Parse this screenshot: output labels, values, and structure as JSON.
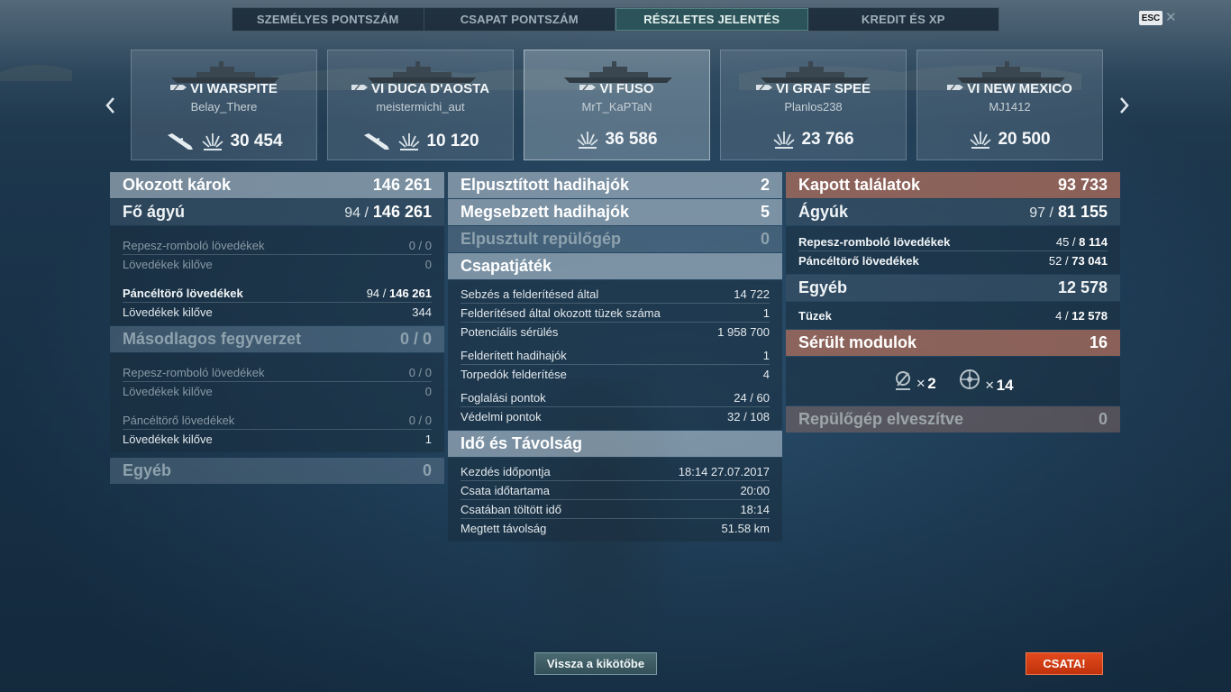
{
  "tabs": [
    {
      "label": "SZEMÉLYES PONTSZÁM",
      "active": false
    },
    {
      "label": "CSAPAT PONTSZÁM",
      "active": false
    },
    {
      "label": "RÉSZLETES JELENTÉS",
      "active": true
    },
    {
      "label": "KREDIT ÉS XP",
      "active": false
    }
  ],
  "esc_label": "ESC",
  "close_glyph": "✕",
  "ships": [
    {
      "tier": "VI",
      "name": "WARSPITE",
      "player": "Belay_There",
      "damage": "30 454",
      "killed": true
    },
    {
      "tier": "VI",
      "name": "DUCA D'AOSTA",
      "player": "meistermichi_aut",
      "damage": "10 120",
      "killed": true
    },
    {
      "tier": "VI",
      "name": "FUSO",
      "player": "MrT_KaPTaN",
      "damage": "36 586",
      "killed": false,
      "selected": true
    },
    {
      "tier": "VI",
      "name": "GRAF SPEE",
      "player": "Planlos238",
      "damage": "23 766",
      "killed": false
    },
    {
      "tier": "VI",
      "name": "NEW MEXICO",
      "player": "MJ1412",
      "damage": "20 500",
      "killed": false
    }
  ],
  "left": {
    "damage_dealt": {
      "label": "Okozott károk",
      "value": "146 261"
    },
    "main_guns": {
      "label": "Fő ágyú",
      "hits": "94 /",
      "dmg": "146 261"
    },
    "he": {
      "label": "Repesz-romboló lövedékek",
      "value": "0 / 0"
    },
    "he_fired": {
      "label": "Lövedékek kilőve",
      "value": "0"
    },
    "ap": {
      "label": "Páncéltörő lövedékek",
      "hits": "94 /",
      "dmg": "146 261"
    },
    "ap_fired": {
      "label": "Lövedékek kilőve",
      "value": "344"
    },
    "secondary": {
      "label": "Másodlagos fegyverzet",
      "value": "0 / 0"
    },
    "sec_he": {
      "label": "Repesz-romboló lövedékek",
      "value": "0 / 0"
    },
    "sec_he_fired": {
      "label": "Lövedékek kilőve",
      "value": "0"
    },
    "sec_ap": {
      "label": "Páncéltörő lövedékek",
      "value": "0 / 0"
    },
    "sec_ap_fired": {
      "label": "Lövedékek kilőve",
      "value": "1"
    },
    "other": {
      "label": "Egyéb",
      "value": "0"
    }
  },
  "middle": {
    "destroyed": {
      "label": "Elpusztított hadihajók",
      "value": "2"
    },
    "damaged": {
      "label": "Megsebzett hadihajók",
      "value": "5"
    },
    "planes": {
      "label": "Elpusztult repülőgép",
      "value": "0"
    },
    "teamplay": {
      "label": "Csapatjáték"
    },
    "spot_dmg": {
      "label": "Sebzés a felderítésed által",
      "value": "14 722"
    },
    "spot_fires": {
      "label": "Felderítésed által okozott tüzek száma",
      "value": "1"
    },
    "potential": {
      "label": "Potenciális sérülés",
      "value": "1 958 700"
    },
    "spotted": {
      "label": "Felderített hadihajók",
      "value": "1"
    },
    "torp_spot": {
      "label": "Torpedók felderítése",
      "value": "4"
    },
    "capture": {
      "label": "Foglalási pontok",
      "value": "24 / 60"
    },
    "defense": {
      "label": "Védelmi pontok",
      "value": "32 / 108"
    },
    "time": {
      "label": "Idő és Távolság"
    },
    "start": {
      "label": "Kezdés időpontja",
      "value": "18:14  27.07.2017"
    },
    "duration": {
      "label": "Csata időtartama",
      "value": "20:00"
    },
    "in_battle": {
      "label": "Csatában töltött idő",
      "value": "18:14"
    },
    "distance": {
      "label": "Megtett távolság",
      "value": "51.58 km"
    }
  },
  "right": {
    "received": {
      "label": "Kapott találatok",
      "value": "93 733"
    },
    "guns": {
      "label": "Ágyúk",
      "hits": "97 /",
      "dmg": "81 155"
    },
    "he": {
      "label": "Repesz-romboló lövedékek",
      "hits": "45 /",
      "dmg": "8 114"
    },
    "ap": {
      "label": "Páncéltörő lövedékek",
      "hits": "52 /",
      "dmg": "73 041"
    },
    "other": {
      "label": "Egyéb",
      "value": "12 578"
    },
    "fires": {
      "label": "Tüzek",
      "hits": "4 /",
      "dmg": "12 578"
    },
    "modules": {
      "label": "Sérült modulok",
      "value": "16"
    },
    "mod_items": [
      {
        "icon": "engine-module-icon",
        "x": "✕",
        "count": "2"
      },
      {
        "icon": "steering-module-icon",
        "x": "✕",
        "count": "14"
      }
    ],
    "planes_lost": {
      "label": "Repülőgép elveszítve",
      "value": "0"
    }
  },
  "buttons": {
    "back": "Vissza a kikötőbe",
    "battle": "CSATA!"
  }
}
